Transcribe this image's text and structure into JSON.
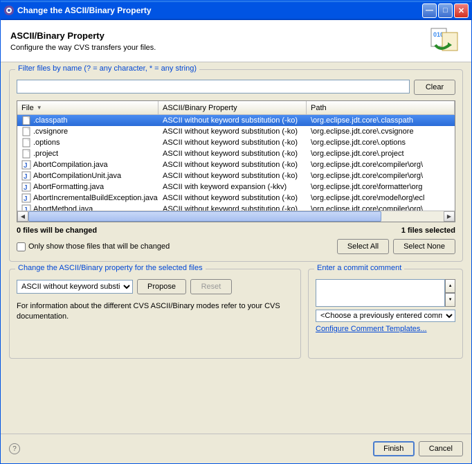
{
  "titlebar": {
    "title": "Change the ASCII/Binary Property"
  },
  "header": {
    "title": "ASCII/Binary Property",
    "subtitle": "Configure the way CVS transfers your files."
  },
  "filter": {
    "group_label": "Filter files by name (? = any character, * = any string)",
    "value": "",
    "clear": "Clear"
  },
  "table": {
    "headers": {
      "file": "File",
      "prop": "ASCII/Binary Property",
      "path": "Path"
    },
    "rows": [
      {
        "file": ".classpath",
        "prop": "ASCII without keyword substitution (-ko)",
        "path": "\\org.eclipse.jdt.core\\.classpath",
        "selected": true,
        "type": "file"
      },
      {
        "file": ".cvsignore",
        "prop": "ASCII without keyword substitution (-ko)",
        "path": "\\org.eclipse.jdt.core\\.cvsignore",
        "type": "file"
      },
      {
        "file": ".options",
        "prop": "ASCII without keyword substitution (-ko)",
        "path": "\\org.eclipse.jdt.core\\.options",
        "type": "file"
      },
      {
        "file": ".project",
        "prop": "ASCII without keyword substitution (-ko)",
        "path": "\\org.eclipse.jdt.core\\.project",
        "type": "file"
      },
      {
        "file": "AbortCompilation.java",
        "prop": "ASCII without keyword substitution (-ko)",
        "path": "\\org.eclipse.jdt.core\\compiler\\org\\",
        "type": "java"
      },
      {
        "file": "AbortCompilationUnit.java",
        "prop": "ASCII without keyword substitution (-ko)",
        "path": "\\org.eclipse.jdt.core\\compiler\\org\\",
        "type": "java"
      },
      {
        "file": "AbortFormatting.java",
        "prop": "ASCII with keyword expansion (-kkv)",
        "path": "\\org.eclipse.jdt.core\\formatter\\org",
        "type": "java"
      },
      {
        "file": "AbortIncrementalBuildException.java",
        "prop": "ASCII without keyword substitution (-ko)",
        "path": "\\org.eclipse.jdt.core\\model\\org\\ecl",
        "type": "java"
      },
      {
        "file": "AbortMethod.java",
        "prop": "ASCII without keyword substitution (-ko)",
        "path": "\\org.eclipse.jdt.core\\compiler\\org\\",
        "type": "java"
      }
    ]
  },
  "status": {
    "changed": "0 files will be changed",
    "selected": "1 files selected",
    "checkbox": "Only show those files that will be changed",
    "select_all": "Select All",
    "select_none": "Select None"
  },
  "change": {
    "group_label": "Change the ASCII/Binary property for the selected files",
    "mode": "ASCII without keyword substitution",
    "propose": "Propose",
    "reset": "Reset",
    "info": "For information about the different CVS ASCII/Binary modes refer to your CVS documentation."
  },
  "comment": {
    "group_label": "Enter a commit comment",
    "value": "",
    "prev": "<Choose a previously entered comment>",
    "link": "Configure Comment Templates..."
  },
  "footer": {
    "finish": "Finish",
    "cancel": "Cancel"
  }
}
